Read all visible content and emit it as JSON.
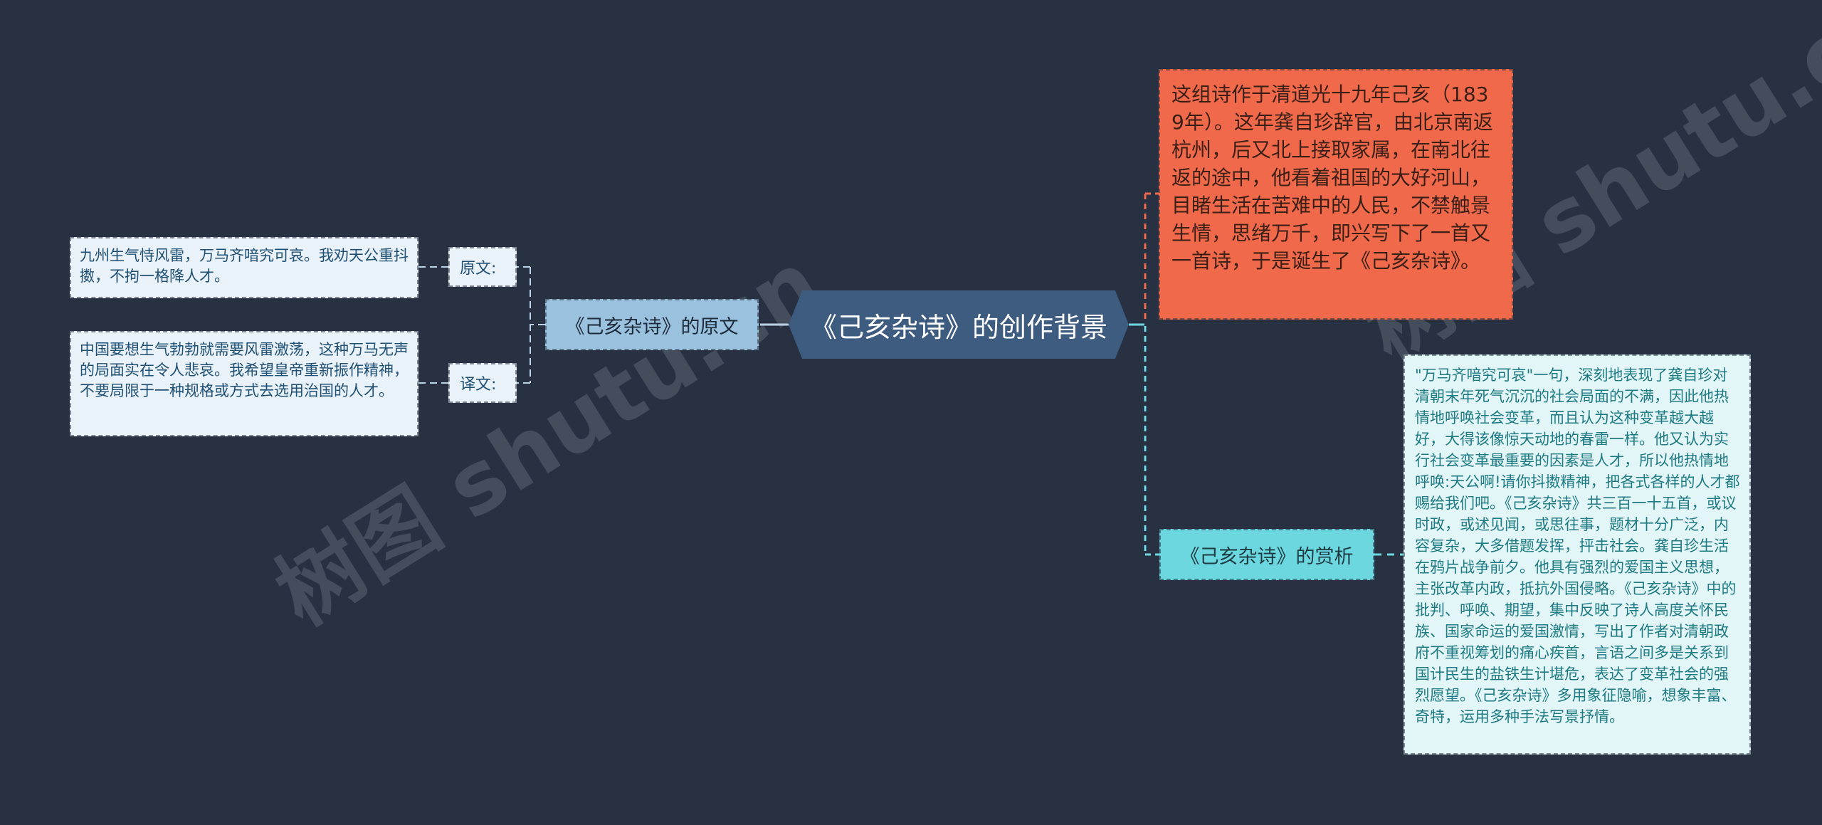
{
  "mindmap": {
    "root": {
      "label": "《己亥杂诗》的创作背景",
      "color": "#3e5b80"
    },
    "left_branch": {
      "label": "《己亥杂诗》的原文",
      "color": "#9ac1de",
      "children": [
        {
          "label": "原文:",
          "content": "九州生气恃风雷，万马齐喑究可哀。我劝天公重抖擞，不拘一格降人才。"
        },
        {
          "label": "译文:",
          "content": "中国要想生气勃勃就需要风雷激荡，这种万马无声的局面实在令人悲哀。我希望皇帝重新振作精神，不要局限于一种规格或方式去选用治国的人才。"
        }
      ]
    },
    "right_branches": [
      {
        "type": "text",
        "color": "#f0694a",
        "content": "这组诗作于清道光十九年己亥（1839年）。这年龚自珍辞官，由北京南返杭州，后又北上接取家属，在南北往返的途中，他看着祖国的大好河山，目睹生活在苦难中的人民，不禁触景生情，思绪万千，即兴写下了一首又一首诗，于是诞生了《己亥杂诗》。"
      },
      {
        "type": "topic",
        "label": "《己亥杂诗》的赏析",
        "color": "#6dd7e0",
        "content": "\"万马齐喑究可哀\"一句，深刻地表现了龚自珍对清朝末年死气沉沉的社会局面的不满，因此他热情地呼唤社会变革，而且认为这种变革越大越好，大得该像惊天动地的春雷一样。他又认为实行社会变革最重要的因素是人才，所以他热情地呼唤:天公啊!请你抖擞精神，把各式各样的人才都赐给我们吧。《己亥杂诗》共三百一十五首，或议时政，或述见闻，或思往事，题材十分广泛，内容复杂，大多借题发挥，抨击社会。龚自珍生活在鸦片战争前夕。他具有强烈的爱国主义思想，主张改革内政，抵抗外国侵略。《己亥杂诗》中的批判、呼唤、期望，集中反映了诗人高度关怀民族、国家命运的爱国激情，写出了作者对清朝政府不重视筹划的痛心疾首，言语之间多是关系到国计民生的盐铁生计堪危，表达了变革社会的强烈愿望。《己亥杂诗》多用象征隐喻，想象丰富、奇特，运用多种手法写景抒情。"
      }
    ],
    "watermark": "树图 shutu.cn"
  },
  "colors": {
    "background": "#283141",
    "link_left": "#b8d2e6",
    "link_orange": "#f0694a",
    "link_cyan": "#6dd7e0"
  }
}
